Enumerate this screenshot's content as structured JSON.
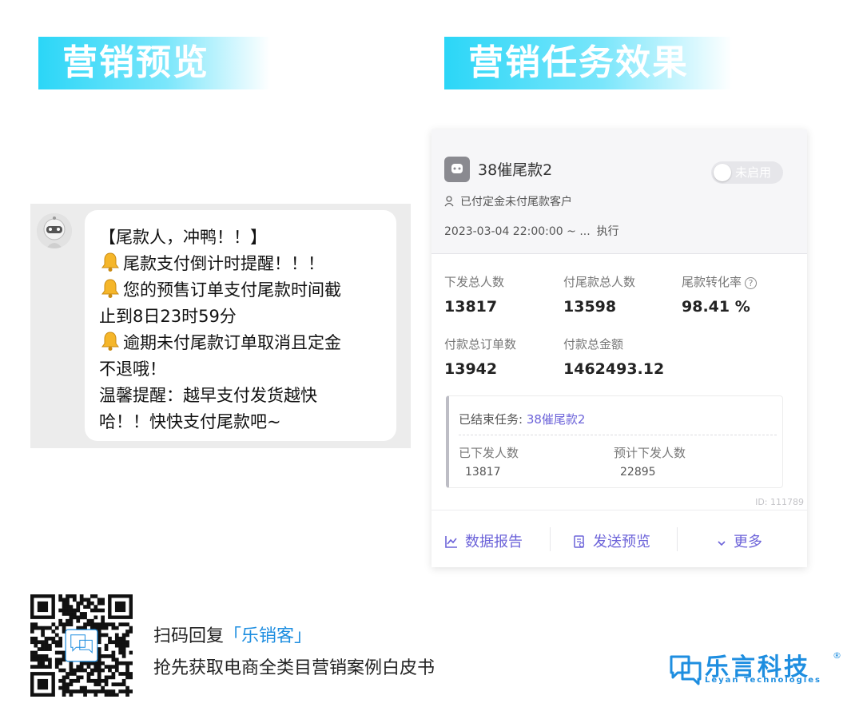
{
  "left_title": "营销预览",
  "right_title": "营销任务效果",
  "chat": {
    "lines": [
      "【尾款人，冲鸭！！】",
      "尾款支付倒计时提醒！！！",
      "您的预售订单支付尾款时间截",
      "止到8日23时59分",
      "逾期未付尾款订单取消且定金",
      "不退哦！",
      "温馨提醒：越早支付发货越快",
      "哈！！快快支付尾款吧~"
    ]
  },
  "task": {
    "name": "38催尾款2",
    "toggle_label": "未启用",
    "audience": "已付定金未付尾款客户",
    "time": "2023-03-04 22:00:00 ~ ...",
    "exec_label": "执行",
    "stats": [
      {
        "label": "下发总人数",
        "value": "13817"
      },
      {
        "label": "付尾款总人数",
        "value": "13598"
      },
      {
        "label": "尾款转化率",
        "value": "98.41 %"
      },
      {
        "label": "付款总订单数",
        "value": "13942"
      },
      {
        "label": "付款总金额",
        "value": "1462493.12"
      }
    ],
    "ended": {
      "label": "已结束任务:",
      "task_link": "38催尾款2",
      "sent_label": "已下发人数",
      "sent_value": "13817",
      "expected_label": "预计下发人数",
      "expected_value": "22895"
    },
    "id_text": "ID: 111789",
    "actions": {
      "report": "数据报告",
      "preview": "发送预览",
      "more": "更多"
    }
  },
  "footer": {
    "scan_text": "扫码回复",
    "keyword": "「乐销客」",
    "sub_text": "抢先获取电商全类目营销案例白皮书",
    "brand_cn": "乐言科技",
    "brand_en": "Leyan Technologies",
    "brand_reg": "®"
  },
  "colors": {
    "title_gradient": "#2bd6f7",
    "accent_purple": "#6c63d9",
    "brand_blue": "#1e8ee0"
  }
}
